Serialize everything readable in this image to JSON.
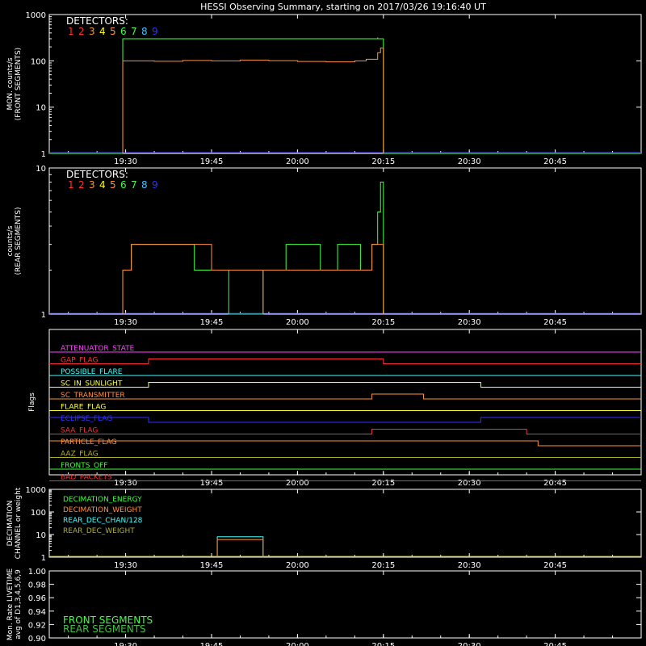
{
  "title": "HESSI Observing Summary, starting on 2017/03/26 19:16:40 UT",
  "colors": {
    "background": "#000000",
    "axes": "#ffffff",
    "det1": "#ff3030",
    "det2": "#ff3030",
    "det3": "#ff9030",
    "det4": "#ffff00",
    "det5": "#ff9030",
    "det6": "#40ff40",
    "det7": "#40ff40",
    "det8": "#40c0ff",
    "det9": "#3030ff",
    "front": "#40ff40",
    "rear_line": "#ff9040",
    "baseline": "#3030ff"
  },
  "time_axis": {
    "unit": "UT",
    "range": [
      "19:16:40",
      "21:00:00"
    ],
    "ticks": [
      "19:30",
      "19:45",
      "20:00",
      "20:15",
      "20:30",
      "20:45"
    ]
  },
  "chart_data": [
    {
      "type": "line",
      "panel": "front",
      "ylabel": "MON. counts/s",
      "ylabel2": "(FRONT SEGMENTS)",
      "yscale": "log",
      "ylim": [
        1,
        1000
      ],
      "yticks": [
        "1",
        "10",
        "100",
        "1000"
      ],
      "legend_title": "DETECTORS:",
      "legend_items": [
        "1",
        "2",
        "3",
        "4",
        "5",
        "6",
        "7",
        "8",
        "9"
      ],
      "series": [
        {
          "color": "#40ff40",
          "x": [
            "19:16:40",
            "19:29:30",
            "19:29:30",
            "20:14:00",
            "20:14:00",
            "20:15:00",
            "20:15:00",
            "21:00:00"
          ],
          "y": [
            1,
            1,
            300,
            320,
            300,
            290,
            1,
            1
          ]
        },
        {
          "color": "#ff9040",
          "x": [
            "19:29:30",
            "19:29:30",
            "19:35",
            "19:40",
            "19:45",
            "19:50",
            "19:55",
            "20:00",
            "20:05",
            "20:10",
            "20:12",
            "20:14",
            "20:14:30",
            "20:15:00",
            "20:15:00"
          ],
          "y": [
            1,
            100,
            98,
            102,
            100,
            104,
            101,
            97,
            95,
            100,
            108,
            150,
            190,
            120,
            1
          ]
        }
      ]
    },
    {
      "type": "line",
      "panel": "rear",
      "ylabel": "counts/s",
      "ylabel2": "(REAR SEGMENTS)",
      "yscale": "log",
      "ylim": [
        1,
        10
      ],
      "yticks": [
        "1",
        "10"
      ],
      "legend_title": "DETECTORS:",
      "legend_items": [
        "1",
        "2",
        "3",
        "4",
        "5",
        "6",
        "7",
        "8",
        "9"
      ],
      "series": [
        {
          "color": "#40ff40",
          "x": [
            "19:29:30",
            "19:29:30",
            "19:31",
            "19:31",
            "19:35",
            "19:35",
            "19:42",
            "19:42",
            "19:44",
            "19:44",
            "19:48",
            "19:48",
            "19:54",
            "19:54",
            "19:58",
            "19:58",
            "20:04",
            "20:04",
            "20:07",
            "20:07",
            "20:11",
            "20:11",
            "20:13",
            "20:13",
            "20:14",
            "20:14:30",
            "20:15:00",
            "20:15:00"
          ],
          "y": [
            1,
            2,
            2,
            3,
            3,
            3,
            3,
            2,
            2,
            2,
            2,
            1,
            1,
            2,
            2,
            3,
            3,
            2,
            2,
            3,
            3,
            2,
            2,
            3,
            5,
            8,
            3,
            1
          ]
        },
        {
          "color": "#ff9040",
          "x": [
            "19:29:30",
            "19:29:30",
            "19:31",
            "19:31",
            "19:45",
            "19:45",
            "19:54",
            "19:54",
            "20:13",
            "20:13",
            "20:15:00",
            "20:15:00"
          ],
          "y": [
            1,
            2,
            2,
            3,
            3,
            2,
            1,
            2,
            2,
            3,
            3,
            1
          ]
        }
      ]
    },
    {
      "type": "line",
      "panel": "flags",
      "ylabel": "Flags",
      "flags": [
        {
          "name": "ATTENUATOR_STATE",
          "color": "#ff40ff",
          "changes": []
        },
        {
          "name": "GAP_FLAG",
          "color": "#ff3030",
          "changes": [
            [
              "19:16:40",
              0
            ],
            [
              "19:34",
              1
            ],
            [
              "20:15",
              0
            ]
          ]
        },
        {
          "name": "POSSIBLE_FLARE",
          "color": "#40ffff",
          "changes": []
        },
        {
          "name": "SC_IN_SUNLIGHT",
          "color": "#ffff40",
          "changes": [
            [
              "19:16:40",
              0
            ],
            [
              "19:34",
              1
            ],
            [
              "20:32",
              0
            ]
          ]
        },
        {
          "name": "SC_TRANSMITTER",
          "color": "#ff9040",
          "changes": [
            [
              "19:16:40",
              0
            ],
            [
              "20:13",
              1
            ],
            [
              "20:22",
              0
            ]
          ]
        },
        {
          "name": "FLARE_FLAG",
          "color": "#ffff40",
          "changes": []
        },
        {
          "name": "ECLIPSE_FLAG",
          "color": "#3030ff",
          "changes": [
            [
              "19:16:40",
              1
            ],
            [
              "19:34",
              0
            ],
            [
              "20:32",
              1
            ]
          ]
        },
        {
          "name": "SAA_FLAG",
          "color": "#ff3030",
          "changes": [
            [
              "19:16:40",
              0
            ],
            [
              "20:13",
              1
            ],
            [
              "20:40",
              0
            ]
          ]
        },
        {
          "name": "PARTICLE_FLAG",
          "color": "#ff9040",
          "changes": [
            [
              "19:16:40",
              1
            ],
            [
              "20:42",
              0
            ]
          ]
        },
        {
          "name": "AAZ_FLAG",
          "color": "#b0b030",
          "changes": []
        },
        {
          "name": "FRONTS_OFF",
          "color": "#40ff40",
          "changes": []
        },
        {
          "name": "BAD_PACKETS",
          "color": "#ff3030",
          "changes": []
        }
      ]
    },
    {
      "type": "line",
      "panel": "decimation",
      "ylabel": "DECIMATION",
      "ylabel2": "CHANNEL or weight",
      "yscale": "log",
      "ylim": [
        1,
        1000
      ],
      "yticks": [
        "1",
        "10",
        "100",
        "1000"
      ],
      "legend_items": [
        "DECIMATION_ENERGY",
        "DECIMATION_WEIGHT",
        "REAR_DEC_CHAN/128",
        "REAR_DEC_WEIGHT"
      ],
      "legend_colors": [
        "#40ff40",
        "#ff9040",
        "#40ffff",
        "#b0b030"
      ],
      "series": [
        {
          "color": "#40ffff",
          "x": [
            "19:46",
            "19:46",
            "19:54",
            "19:54"
          ],
          "y": [
            1,
            8,
            8,
            1
          ]
        },
        {
          "color": "#ff9040",
          "x": [
            "19:46",
            "19:46",
            "19:54",
            "19:54"
          ],
          "y": [
            1,
            6,
            6,
            1
          ]
        }
      ]
    },
    {
      "type": "line",
      "panel": "livetime",
      "ylabel": "Mon. Rate LIVETIME",
      "ylabel2": "avg of D1,3,4,5,6,9",
      "ylim": [
        0.9,
        1.0
      ],
      "yticks": [
        "0.90",
        "0.92",
        "0.94",
        "0.96",
        "0.98",
        "1.00"
      ],
      "legend_items": [
        "FRONT SEGMENTS",
        "REAR SEGMENTS"
      ],
      "legend_colors": [
        "#40ff40",
        "#40c040"
      ],
      "series": []
    }
  ]
}
